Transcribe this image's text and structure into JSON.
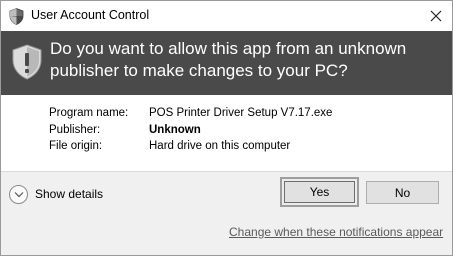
{
  "window": {
    "title": "User Account Control",
    "icon": "uac-shield-icon",
    "close_icon": "close-icon"
  },
  "banner": {
    "question": "Do you want to allow this app from an unknown publisher to make changes to your PC?",
    "icon": "warning-shield-icon",
    "background_color": "#4a4a4a",
    "text_color": "#ffffff"
  },
  "details": {
    "program_name_label": "Program name:",
    "program_name_value": "POS Printer Driver Setup V7.17.exe",
    "publisher_label": "Publisher:",
    "publisher_value": "Unknown",
    "file_origin_label": "File origin:",
    "file_origin_value": "Hard drive on this computer"
  },
  "footer": {
    "show_details_label": "Show details",
    "show_details_icon": "chevron-down-icon",
    "yes_label": "Yes",
    "no_label": "No",
    "notifications_link": "Change when these notifications appear",
    "background_color": "#f0f0f0"
  }
}
